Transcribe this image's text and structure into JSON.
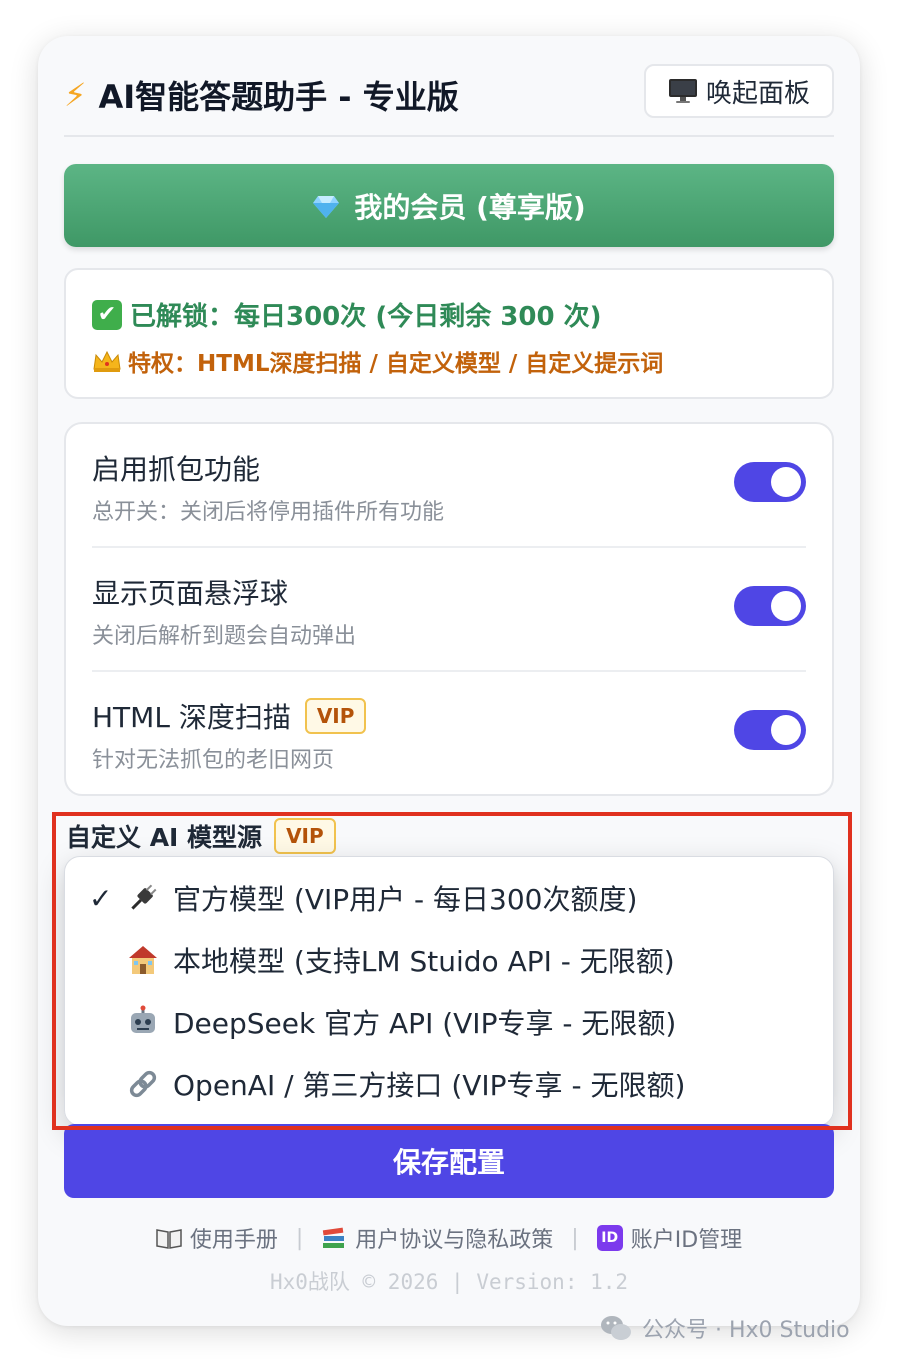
{
  "header": {
    "title": "AI智能答题助手 - 专业版",
    "wake_button": "唤起面板"
  },
  "membership": {
    "button_label": "我的会员 (尊享版)"
  },
  "status": {
    "unlocked": "已解锁：每日300次 (今日剩余 300 次)",
    "privileges": "特权：HTML深度扫描 / 自定义模型 / 自定义提示词"
  },
  "toggles": [
    {
      "label": "启用抓包功能",
      "desc": "总开关：关闭后将停用插件所有功能",
      "on": true
    },
    {
      "label": "显示页面悬浮球",
      "desc": "关闭后解析到题会自动弹出",
      "on": true
    },
    {
      "label": "HTML 深度扫描",
      "badge": "VIP",
      "desc": "针对无法抓包的老旧网页",
      "on": true
    }
  ],
  "model_source": {
    "label": "自定义 AI 模型源",
    "badge": "VIP",
    "options": [
      {
        "label": "官方模型 (VIP用户 - 每日300次额度)",
        "icon": "plug-icon",
        "selected": true
      },
      {
        "label": "本地模型 (支持LM Stuido API - 无限额)",
        "icon": "house-icon",
        "selected": false
      },
      {
        "label": "DeepSeek 官方 API (VIP专享 - 无限额)",
        "icon": "robot-icon",
        "selected": false
      },
      {
        "label": "OpenAI / 第三方接口 (VIP专享 - 无限额)",
        "icon": "link-icon",
        "selected": false
      }
    ],
    "check_mark": "✓"
  },
  "save_button": "保存配置",
  "footer": {
    "manual": "使用手册",
    "policy": "用户协议与隐私政策",
    "account": "账户ID管理",
    "account_badge": "ID",
    "separator": "|",
    "copyright": "Hx0战队 © 2026 | Version: 1.2"
  },
  "watermark": "公众号 · Hx0 Studio",
  "colors": {
    "accent": "#4f46e5",
    "member_green": "#4fa873",
    "status_green": "#2f8a57",
    "privilege_orange": "#c2620b",
    "highlight_red": "#e0311f"
  }
}
